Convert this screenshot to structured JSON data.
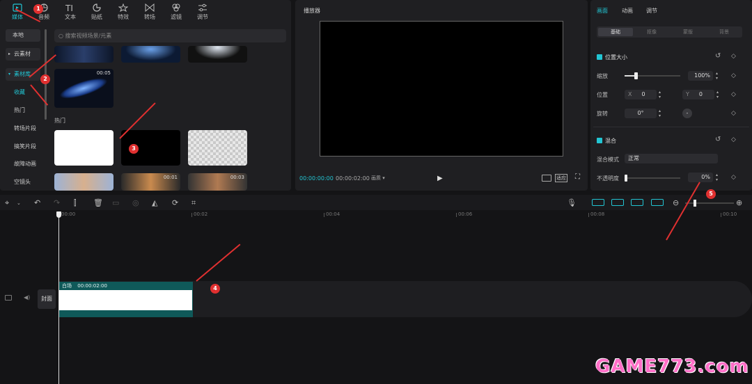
{
  "top_tabs": [
    {
      "label": "媒体",
      "icon": "media-icon"
    },
    {
      "label": "音频",
      "icon": "audio-icon"
    },
    {
      "label": "文本",
      "icon": "text-icon"
    },
    {
      "label": "贴纸",
      "icon": "sticker-icon"
    },
    {
      "label": "特效",
      "icon": "effects-icon"
    },
    {
      "label": "转场",
      "icon": "transition-icon"
    },
    {
      "label": "滤镜",
      "icon": "filter-icon"
    },
    {
      "label": "调节",
      "icon": "adjust-icon"
    }
  ],
  "sidebar": {
    "local": "本地",
    "cloud": "云素材",
    "library": "素材库",
    "items": [
      "收藏",
      "热门",
      "转场片段",
      "搞笑片段",
      "故障动画",
      "空镜头"
    ]
  },
  "search": {
    "placeholder": "搜索视频场景/元素"
  },
  "media": {
    "hot_heading": "热门",
    "clip_durations": [
      "00:05",
      "00:01",
      "00:03"
    ]
  },
  "player": {
    "title": "播放器",
    "current_time": "00:00:00:00",
    "total_time": "00:00:02:00",
    "view_mode": "画质",
    "ratio_label": "适应"
  },
  "inspector": {
    "tabs": [
      "画面",
      "动画",
      "调节"
    ],
    "subtabs": [
      "基础",
      "抠像",
      "蒙版",
      "背景"
    ],
    "position_section": "位置大小",
    "scale_label": "缩放",
    "scale_value": "100%",
    "scale_fraction": 0.2,
    "position_label": "位置",
    "x_label": "X",
    "x_value": "0",
    "y_label": "Y",
    "y_value": "0",
    "rotate_label": "旋转",
    "rotate_value": "0°",
    "blend_section": "混合",
    "blend_mode_label": "混合模式",
    "blend_mode_value": "正常",
    "opacity_label": "不透明度",
    "opacity_value": "0%",
    "opacity_fraction": 0.0
  },
  "timeline": {
    "ruler": [
      "00:00",
      "00:02",
      "00:04",
      "00:06",
      "00:08",
      "00:10"
    ],
    "cover_label": "封面",
    "clip_name": "白场",
    "clip_duration": "00:00:02:00"
  },
  "annotations": [
    "1",
    "2",
    "3",
    "4",
    "5"
  ],
  "watermark": "GAME773.com",
  "colors": {
    "accent": "#22c5d3",
    "annotation": "#e03030",
    "clip_header": "#0f5959"
  }
}
